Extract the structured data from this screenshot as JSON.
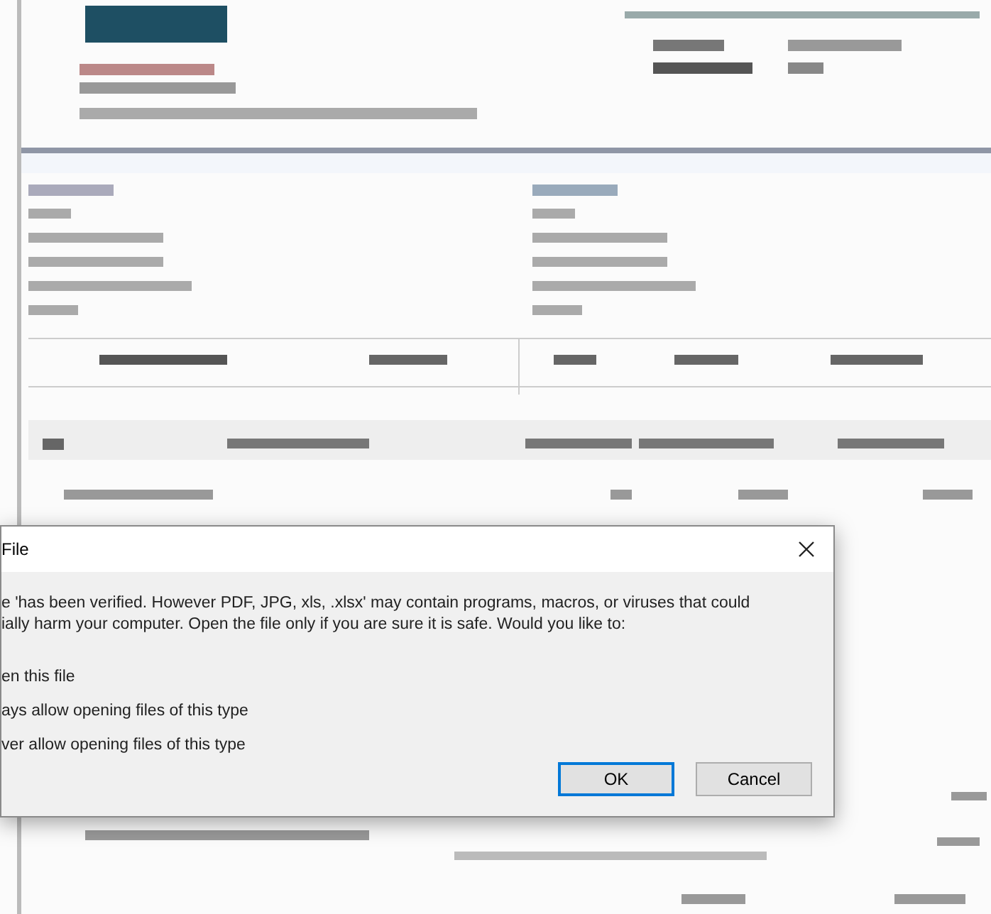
{
  "dialog": {
    "title": "File",
    "message_lines": [
      "e 'has been verified. However PDF, JPG, xls, .xlsx' may contain programs, macros, or viruses that could",
      "ially harm your computer. Open the file only if you are sure it is safe. Would you like to:"
    ],
    "options": [
      "en this file",
      "ays allow opening files of this type",
      "ver allow opening files of this type"
    ],
    "buttons": [
      {
        "label": "OK",
        "focused": true
      },
      {
        "label": "Cancel",
        "focused": false
      }
    ]
  }
}
